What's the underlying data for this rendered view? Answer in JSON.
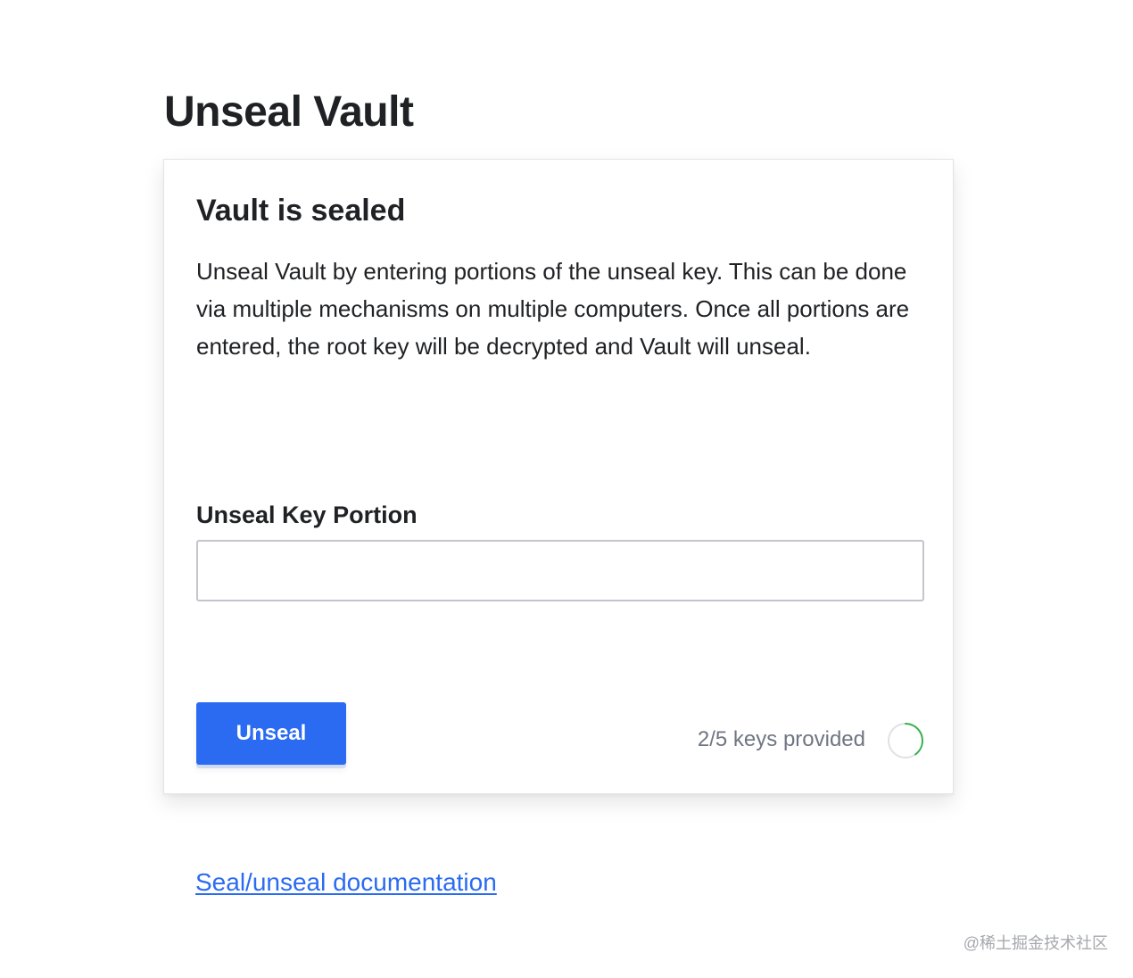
{
  "page": {
    "title": "Unseal Vault"
  },
  "card": {
    "title": "Vault is sealed",
    "description": "Unseal Vault by entering portions of the unseal key. This can be done via multiple mechanisms on multiple computers. Once all portions are entered, the root key will be decrypted and Vault will unseal."
  },
  "form": {
    "field_label": "Unseal Key Portion",
    "field_value": "",
    "submit_label": "Unseal"
  },
  "progress": {
    "text": "2/5 keys provided",
    "provided": 2,
    "total": 5,
    "ring_color": "#37b24d",
    "track_color": "#dfe1e5"
  },
  "footer": {
    "doc_link_label": "Seal/unseal documentation"
  },
  "watermark": {
    "text": "@稀土掘金技术社区"
  },
  "colors": {
    "accent": "#2a6bf2",
    "text": "#1f2124",
    "muted": "#6f7682"
  }
}
